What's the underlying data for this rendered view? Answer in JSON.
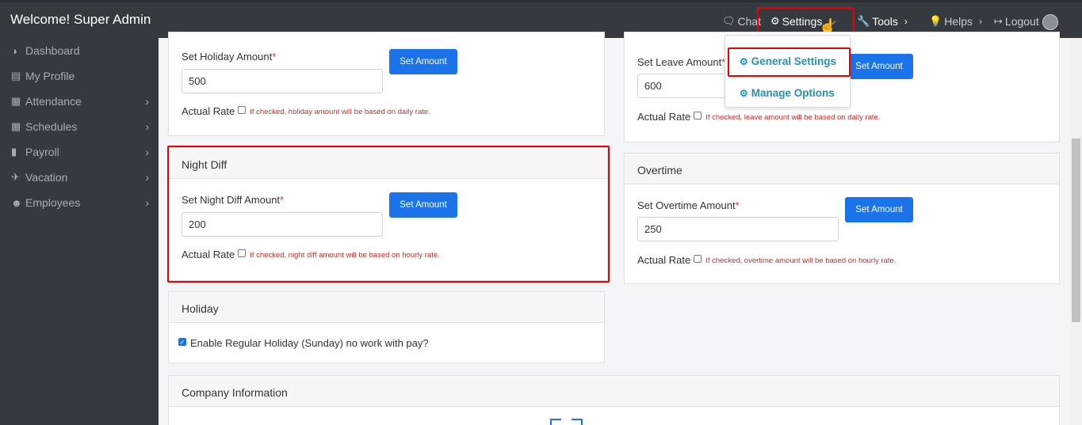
{
  "topbar": {
    "welcome": "Welcome! Super Admin",
    "chat": "Chat",
    "settings": "Settings",
    "tools": "Tools",
    "helps": "Helps",
    "logout": "Logout"
  },
  "dropdown": {
    "general_settings": "General Settings",
    "manage_options": "Manage Options"
  },
  "sidebar": {
    "items": [
      {
        "label": "Dashboard",
        "icon": "dashboard-icon"
      },
      {
        "label": "My Profile",
        "icon": "id-card-icon"
      },
      {
        "label": "Attendance",
        "icon": "calendar-icon"
      },
      {
        "label": "Schedules",
        "icon": "table-icon"
      },
      {
        "label": "Payroll",
        "icon": "file-icon"
      },
      {
        "label": "Vacation",
        "icon": "plane-icon"
      },
      {
        "label": "Employees",
        "icon": "users-icon"
      }
    ]
  },
  "holiday_amount": {
    "label": "Set Holiday Amount",
    "required": "*",
    "value": "500",
    "button": "Set Amount",
    "rate_label": "Actual Rate",
    "hint": "If checked, holiday amount will be based on daily rate."
  },
  "leave_amount": {
    "label": "Set Leave Amount",
    "required": "*",
    "value": "600",
    "button": "Set Amount",
    "rate_label": "Actual Rate",
    "hint": "If checked, leave amount will be based on daily rate."
  },
  "night_diff": {
    "title": "Night Diff",
    "label": "Set Night Diff Amount",
    "required": "*",
    "value": "200",
    "button": "Set Amount",
    "rate_label": "Actual Rate",
    "hint": "If checked, night diff amount will be based on hourly rate."
  },
  "overtime": {
    "title": "Overtime",
    "label": "Set Overtime Amount",
    "required": "*",
    "value": "250",
    "button": "Set Amount",
    "rate_label": "Actual Rate",
    "hint": "If checked, overtime amount will be based on hourly rate."
  },
  "holiday": {
    "title": "Holiday",
    "option": "Enable Regular Holiday (Sunday) no work with pay?"
  },
  "company": {
    "title": "Company Information"
  },
  "colors": {
    "accent": "#1a73e8",
    "highlight": "#e00000",
    "dropdown_text": "#2193b0"
  }
}
